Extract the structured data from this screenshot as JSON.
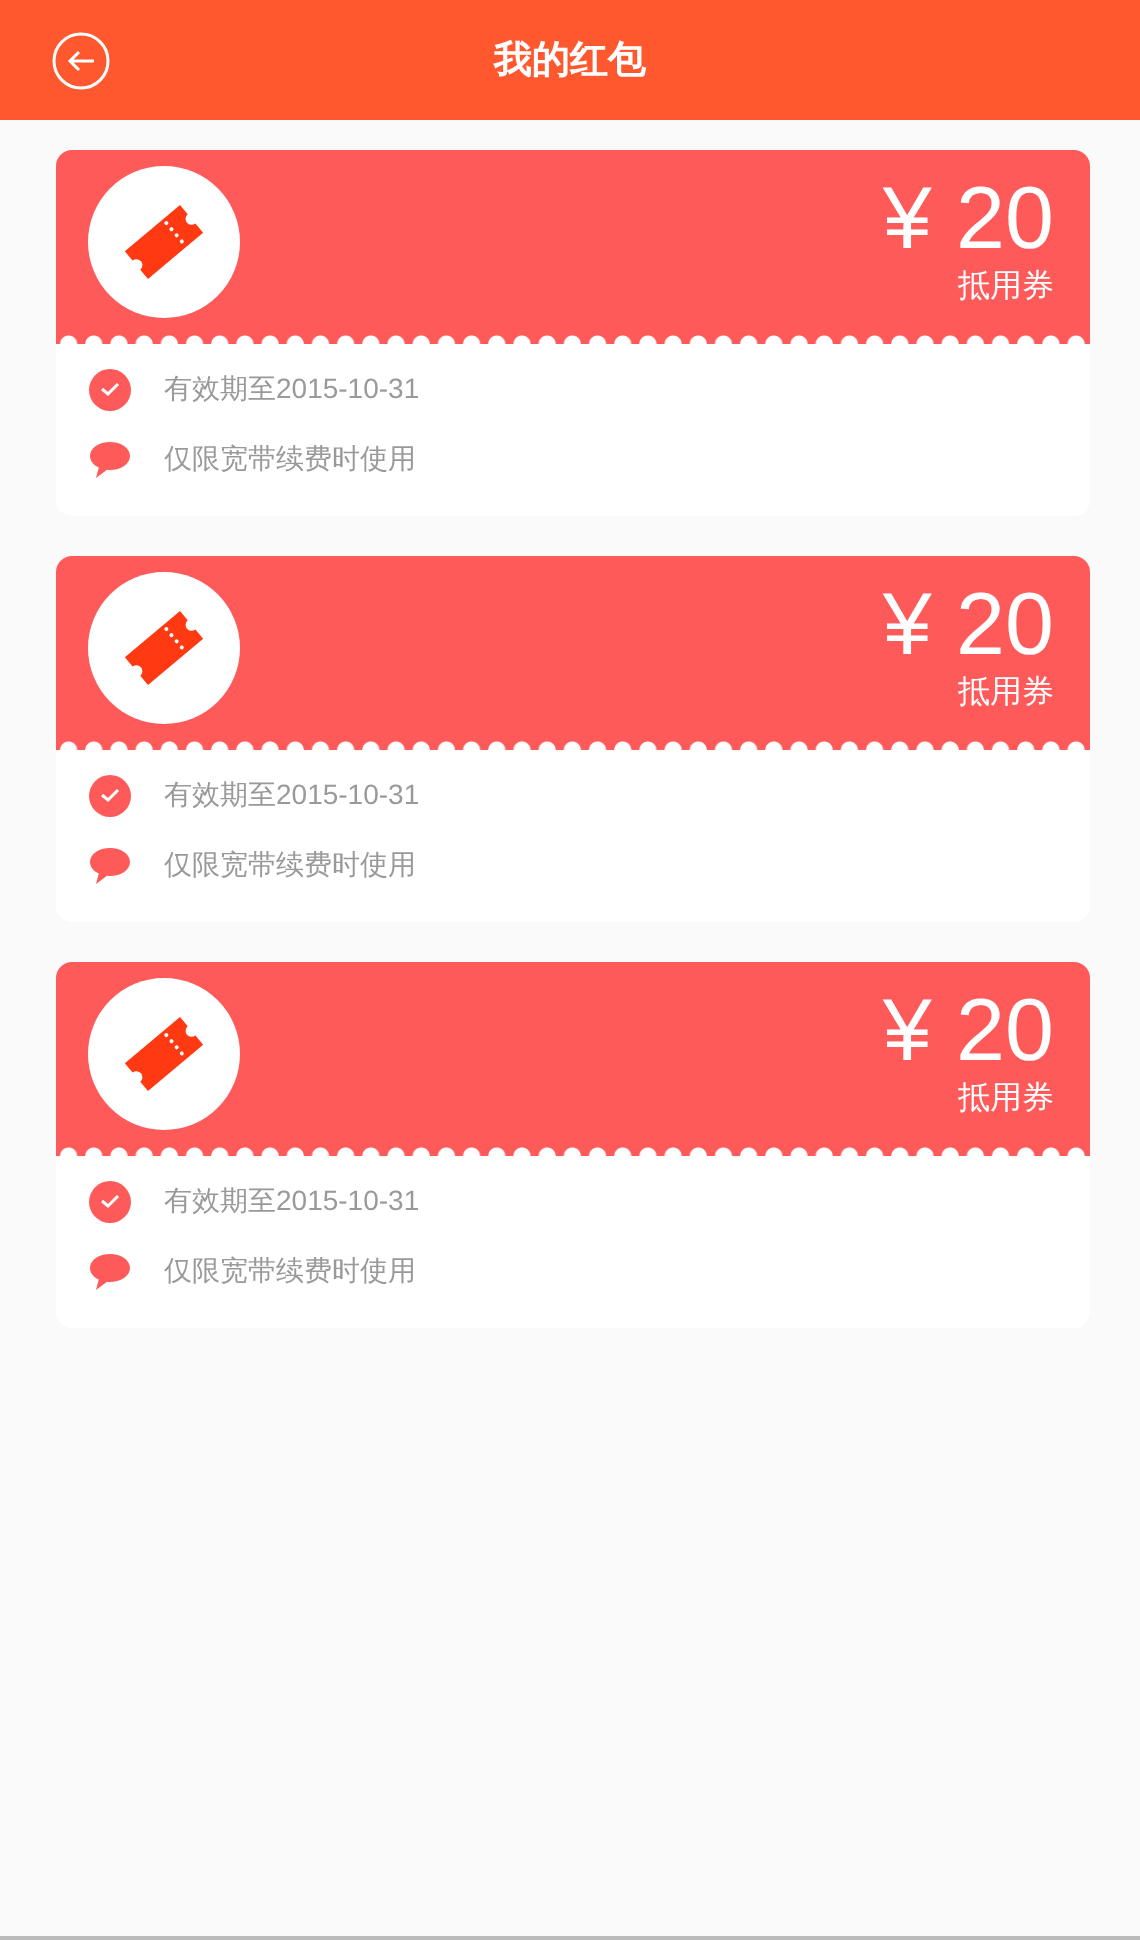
{
  "header": {
    "title": "我的红包"
  },
  "coupons": [
    {
      "amount": "¥ 20",
      "type": "抵用券",
      "validity": "有效期至2015-10-31",
      "restriction": "仅限宽带续费时使用"
    },
    {
      "amount": "¥ 20",
      "type": "抵用券",
      "validity": "有效期至2015-10-31",
      "restriction": "仅限宽带续费时使用"
    },
    {
      "amount": "¥ 20",
      "type": "抵用券",
      "validity": "有效期至2015-10-31",
      "restriction": "仅限宽带续费时使用"
    }
  ]
}
